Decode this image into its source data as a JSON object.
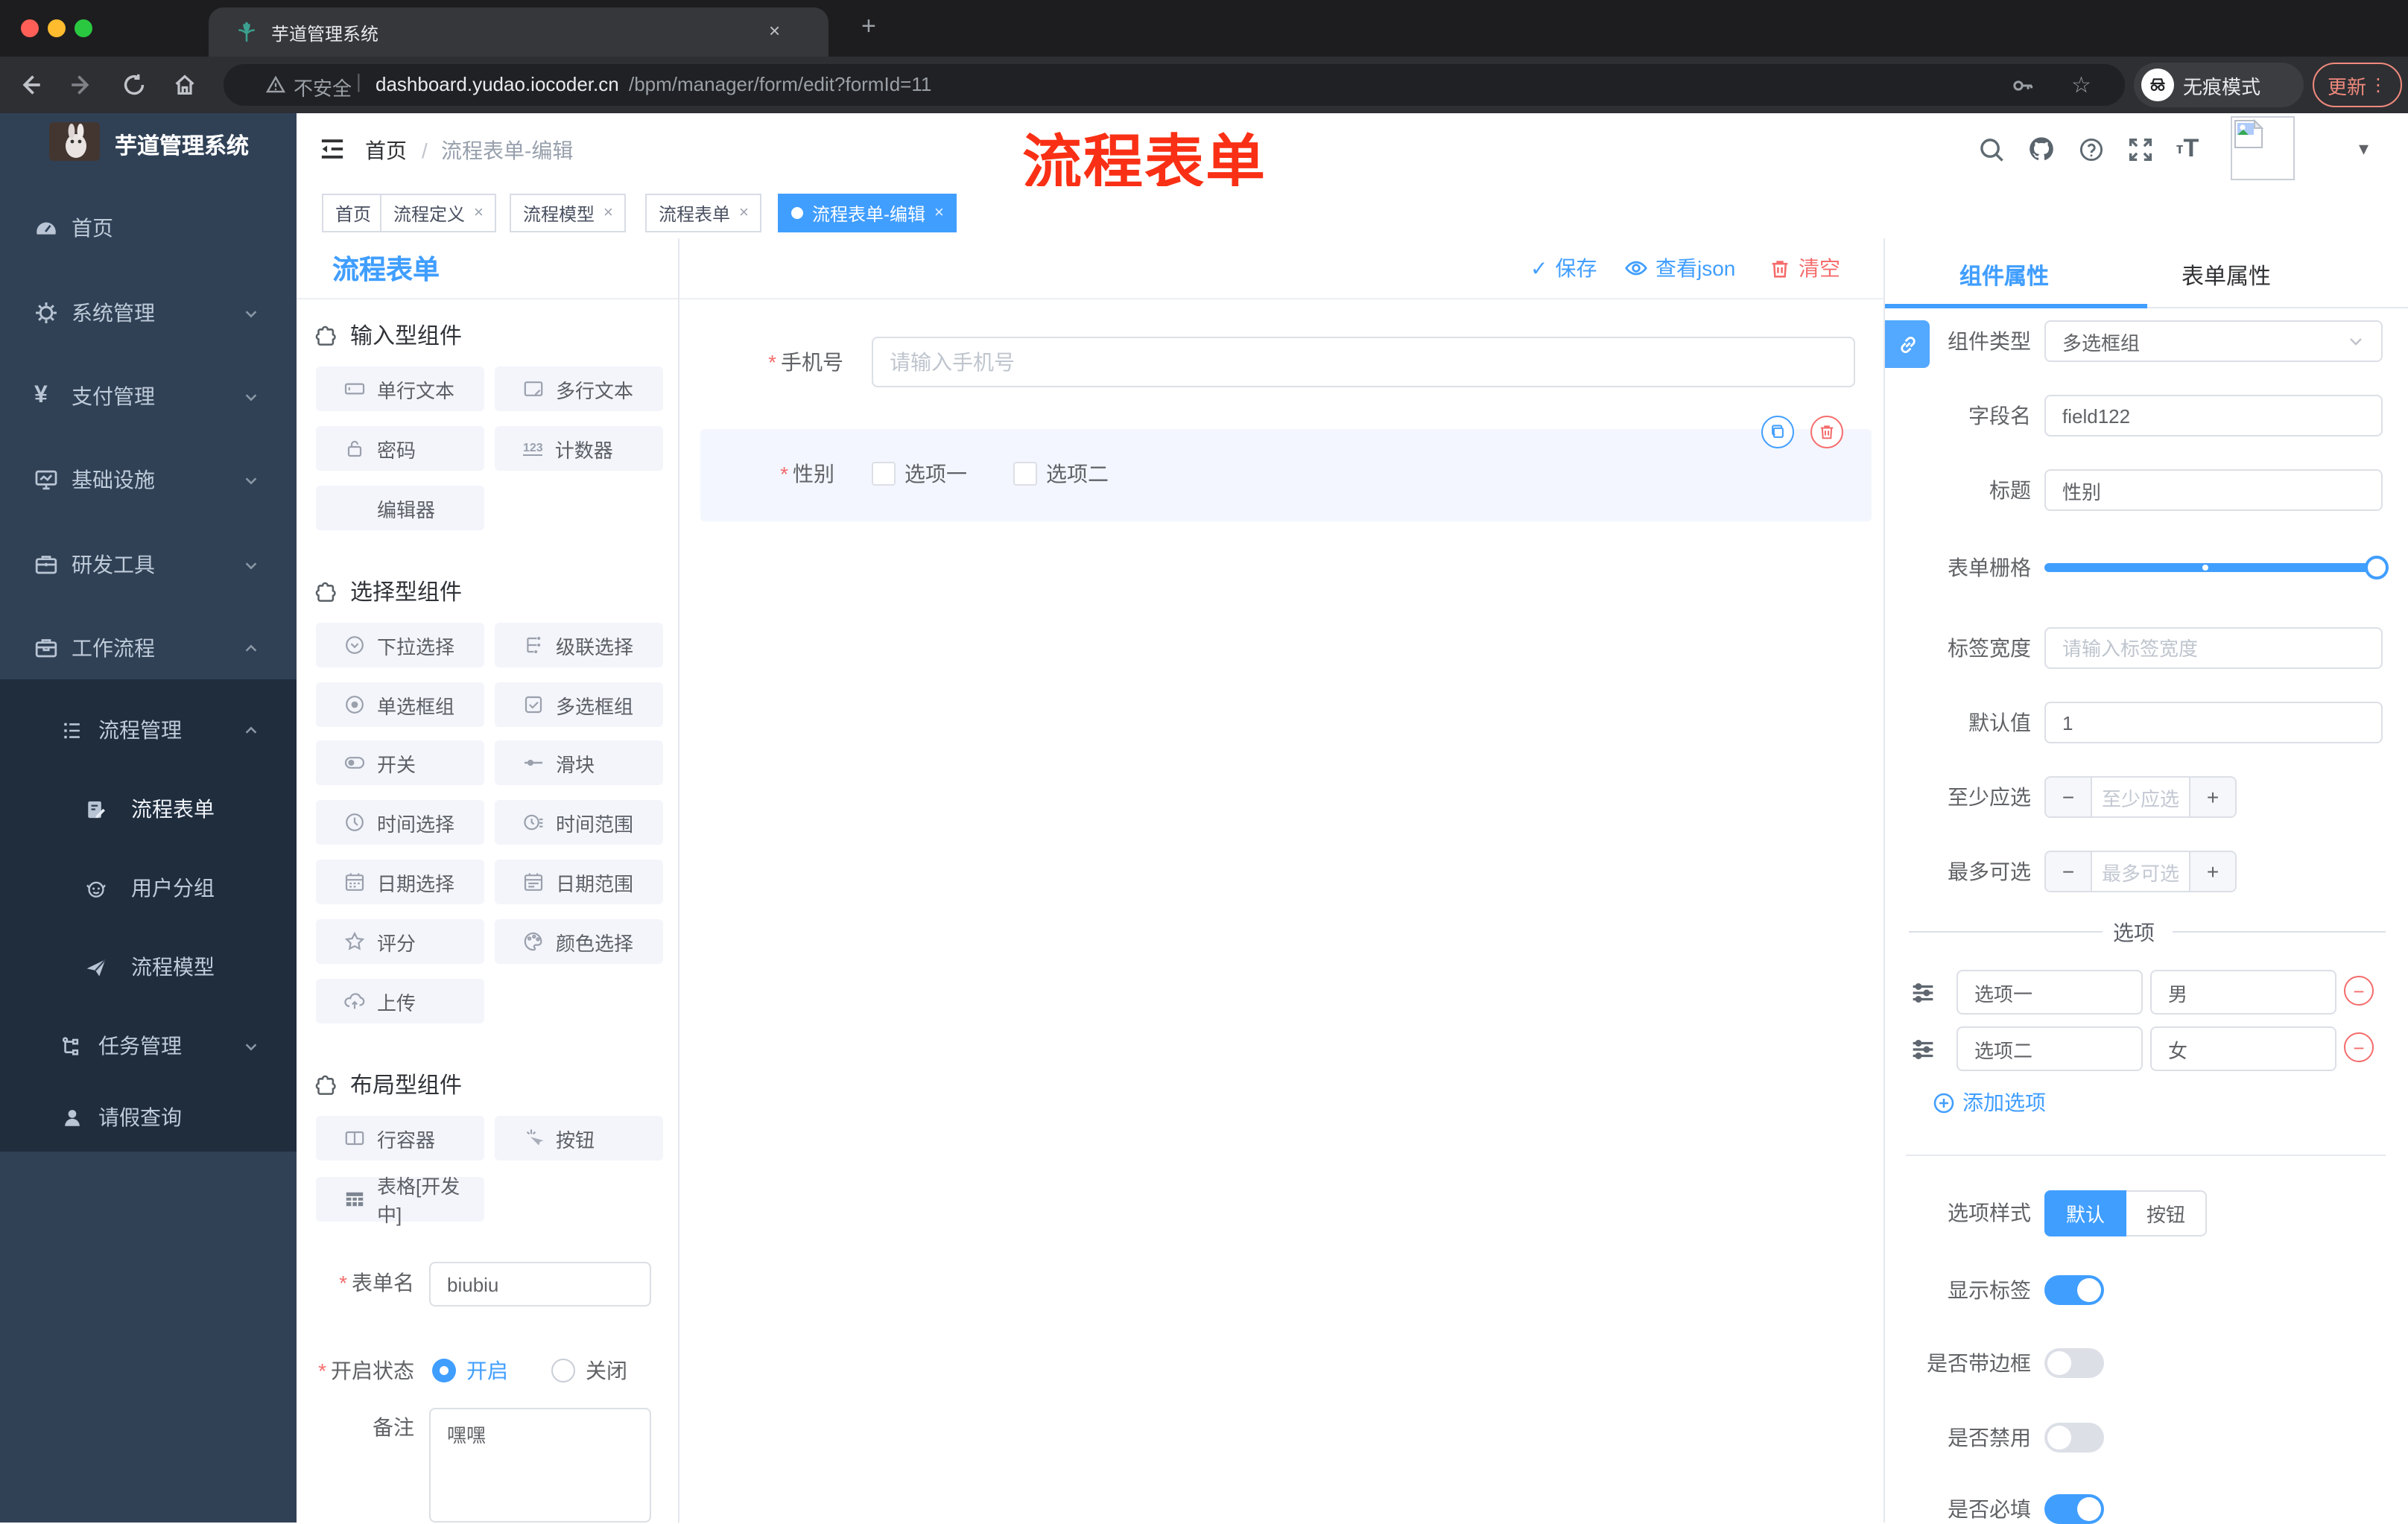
{
  "browser": {
    "tab_title": "芋道管理系统",
    "security_label": "不安全",
    "url_host": "dashboard.yudao.iocoder.cn",
    "url_path": "/bpm/manager/form/edit?formId=11",
    "incognito_label": "无痕模式",
    "update_label": "更新"
  },
  "icons": {
    "close": "×",
    "plus": "+",
    "minus": "−",
    "check": "✓",
    "more": "⋮",
    "caret": "▾",
    "dot_slash": "/",
    "req": "*",
    "yen": "¥",
    "star": "☆",
    "question": "?",
    "font_small": "т",
    "font_big": "T",
    "num123": "123"
  },
  "annotation": {
    "text": "流程表单",
    "color": "#f93015"
  },
  "sidebar": {
    "logo_title": "芋道管理系统",
    "items": [
      "首页",
      "系统管理",
      "支付管理",
      "基础设施",
      "研发工具",
      "工作流程",
      "流程管理",
      "流程表单",
      "用户分组",
      "流程模型",
      "任务管理",
      "请假查询"
    ]
  },
  "header": {
    "breadcrumb_home": "首页",
    "breadcrumb_sep": "/",
    "breadcrumb_current": "流程表单-编辑"
  },
  "tags": {
    "items": [
      "首页",
      "流程定义",
      "流程模型",
      "流程表单",
      "流程表单-编辑"
    ]
  },
  "designer": {
    "panel_title": "流程表单",
    "toolbar": {
      "save": "保存",
      "view_json": "查看json",
      "clear": "清空"
    },
    "groups": [
      {
        "title": "输入型组件",
        "items": [
          "单行文本",
          "多行文本",
          "密码",
          "计数器",
          "编辑器"
        ]
      },
      {
        "title": "选择型组件",
        "items": [
          "下拉选择",
          "级联选择",
          "单选框组",
          "多选框组",
          "开关",
          "滑块",
          "时间选择",
          "时间范围",
          "日期选择",
          "日期范围",
          "评分",
          "颜色选择",
          "上传"
        ]
      },
      {
        "title": "布局型组件",
        "items": [
          "行容器",
          "按钮",
          "表格[开发中]"
        ]
      }
    ],
    "meta": {
      "form_name_label": "表单名",
      "form_name_value": "biubiu",
      "status_label": "开启状态",
      "status_on": "开启",
      "status_off": "关闭",
      "remark_label": "备注",
      "remark_value": "嘿嘿"
    },
    "canvas": {
      "phone_label": "手机号",
      "phone_placeholder": "请输入手机号",
      "gender_label": "性别",
      "gender_opt1": "选项一",
      "gender_opt2": "选项二"
    }
  },
  "properties": {
    "tab_component": "组件属性",
    "tab_form": "表单属性",
    "component_type_label": "组件类型",
    "component_type_value": "多选框组",
    "field_name_label": "字段名",
    "field_name_value": "field122",
    "title_label": "标题",
    "title_value": "性别",
    "grid_label": "表单栅格",
    "label_width_label": "标签宽度",
    "label_width_placeholder": "请输入标签宽度",
    "default_label": "默认值",
    "default_value": "1",
    "min_label": "至少应选",
    "min_placeholder": "至少应选",
    "max_label": "最多可选",
    "max_placeholder": "最多可选",
    "options_title": "选项",
    "option1_label": "选项一",
    "option1_value": "男",
    "option2_label": "选项二",
    "option2_value": "女",
    "add_option": "添加选项",
    "style_label": "选项样式",
    "style_default": "默认",
    "style_button": "按钮",
    "show_label": "显示标签",
    "border_label": "是否带边框",
    "disabled_label": "是否禁用",
    "required_label": "是否必填"
  },
  "colors": {
    "accent": "#409eff",
    "danger": "#f56c6c",
    "sidebar_bg": "#304156",
    "submenu_bg": "#1f2d3d",
    "update_red": "#f08a7d"
  }
}
